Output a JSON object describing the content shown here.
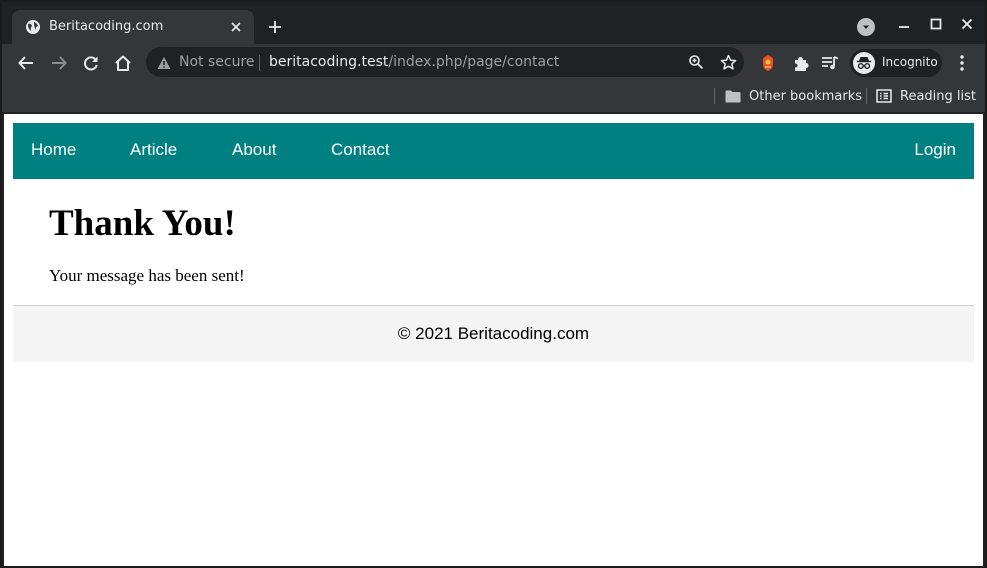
{
  "browser": {
    "tab": {
      "title": "Beritacoding.com"
    },
    "omnibox": {
      "security_label": "Not secure",
      "url_host": "beritacoding.test",
      "url_path": "/index.php/page/contact"
    },
    "profile": {
      "label": "Incognito"
    },
    "bookmarks": {
      "other_bookmarks": "Other bookmarks",
      "reading_list": "Reading list"
    },
    "icons": {
      "tab_favicon": "globe-icon",
      "tab_close": "close-icon",
      "new_tab": "plus-icon",
      "tab_search": "chevron-down-icon",
      "back": "arrow-left-icon",
      "forward": "arrow-right-icon",
      "reload": "reload-icon",
      "home": "home-icon",
      "warning": "warning-icon",
      "zoom": "zoom-icon",
      "bookmark_star": "star-icon",
      "extension_red": "extension-icon",
      "extensions": "puzzle-icon",
      "media": "media-queue-icon",
      "incognito": "incognito-icon",
      "menu": "more-vert-icon"
    },
    "colors": {
      "frame": "#202124",
      "toolbar": "#35363a",
      "text": "#e8eaed",
      "muted": "#9aa0a6"
    }
  },
  "site": {
    "nav": {
      "items": [
        {
          "label": "Home"
        },
        {
          "label": "Article"
        },
        {
          "label": "About"
        },
        {
          "label": "Contact"
        }
      ],
      "login": "Login"
    },
    "heading": "Thank You!",
    "message": "Your message has been sent!",
    "footer": "© 2021 Beritacoding.com",
    "colors": {
      "nav_bg": "#008080",
      "footer_bg": "#f4f4f4"
    }
  }
}
